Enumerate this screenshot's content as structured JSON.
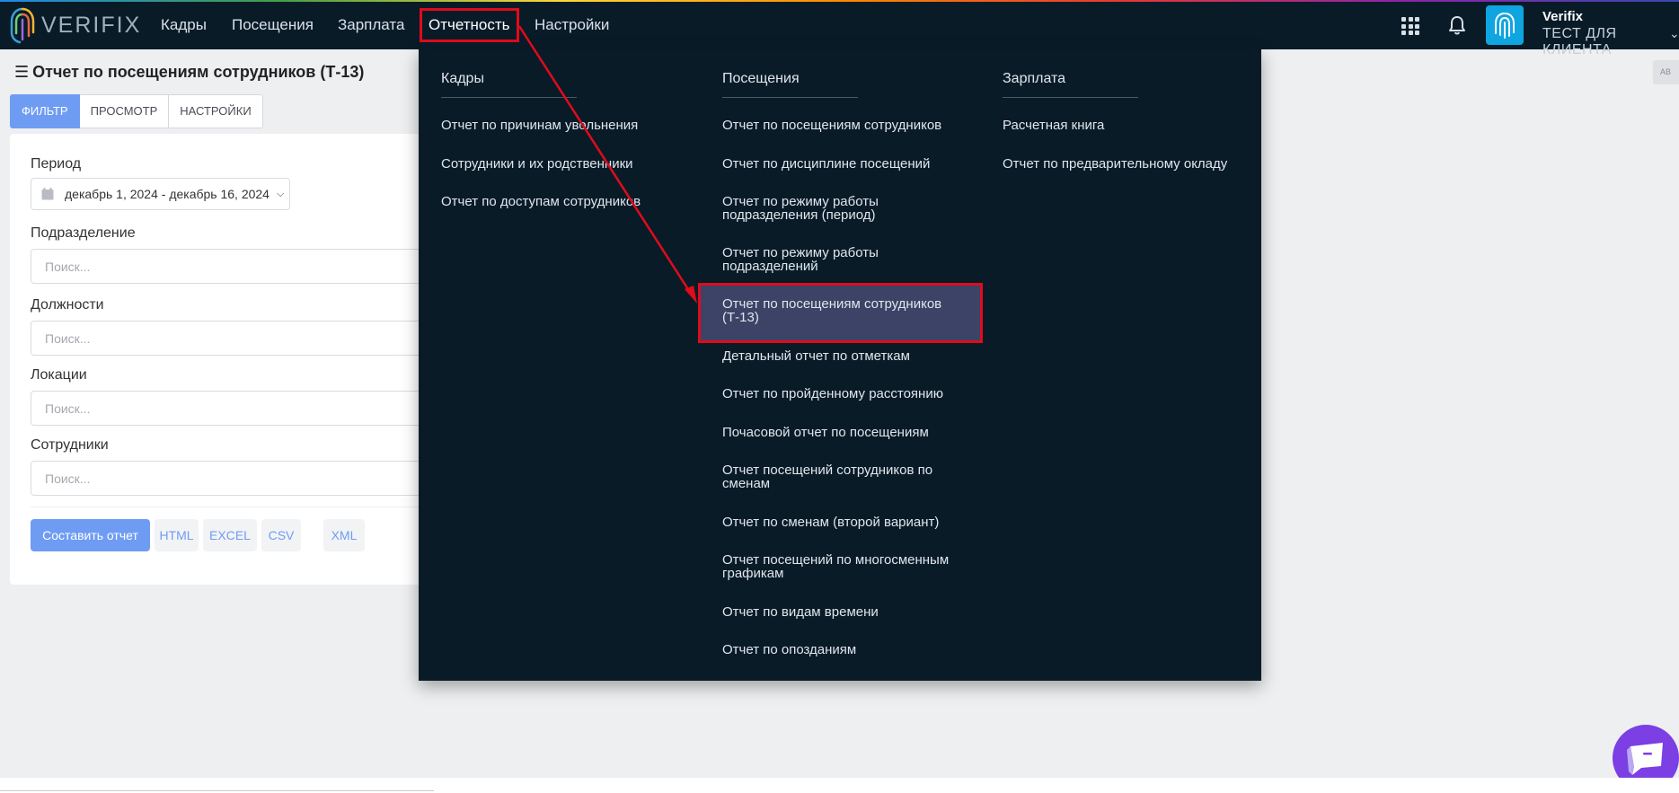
{
  "app": {
    "brand": "VERIFIX"
  },
  "nav": {
    "items": [
      "Кадры",
      "Посещения",
      "Зарплата",
      "Отчетность",
      "Настройки"
    ],
    "active": "Отчетность"
  },
  "user": {
    "name": "Verifix",
    "company": "ТЕСТ ДЛЯ КЛИЕНТА"
  },
  "page": {
    "title": "Отчет по посещениям сотрудников (Т-13)",
    "tabs": [
      "ФИЛЬТР",
      "ПРОСМОТР",
      "НАСТРОЙКИ"
    ],
    "active_tab": "ФИЛЬТР"
  },
  "filters": {
    "period_label": "Период",
    "period_value": "декабрь 1, 2024 - декабрь 16, 2024",
    "fields": [
      {
        "label": "Подразделение",
        "placeholder": "Поиск..."
      },
      {
        "label": "Должности",
        "placeholder": "Поиск..."
      },
      {
        "label": "Локации",
        "placeholder": "Поиск..."
      },
      {
        "label": "Сотрудники",
        "placeholder": "Поиск..."
      }
    ]
  },
  "actions": {
    "build": "Составить отчет",
    "exports": [
      "HTML",
      "EXCEL",
      "CSV",
      "XML"
    ]
  },
  "reports_menu": {
    "columns": [
      {
        "heading": "Кадры",
        "links": [
          "Отчет по причинам увольнения",
          "Сотрудники и их родственники",
          "Отчет по доступам сотрудников"
        ]
      },
      {
        "heading": "Посещения",
        "links": [
          "Отчет по посещениям сотрудников",
          "Отчет по дисциплине посещений",
          "Отчет по режиму работы подразделения (период)",
          "Отчет по режиму работы подразделений",
          "Отчет по посещениям сотрудников (Т-13)",
          "Детальный отчет по отметкам",
          "Отчет по пройденному расстоянию",
          "Почасовой отчет по посещениям",
          "Отчет посещений сотрудников по сменам",
          "Отчет по сменам (второй вариант)",
          "Отчет посещений по многосменным графикам",
          "Отчет по видам времени",
          "Отчет по опозданиям"
        ]
      },
      {
        "heading": "Зарплата",
        "links": [
          "Расчетная книга",
          "Отчет по предварительному окладу"
        ]
      }
    ],
    "selected": "Отчет по посещениям сотрудников (Т-13)"
  },
  "colors": {
    "topbar": "#0a1b28",
    "accent": "#6f9cf3",
    "highlight": "#e00b1b",
    "selected_item": "#3c4366",
    "chat": "#7b3fe4"
  },
  "icons": [
    "apps-grid-icon",
    "bell-icon",
    "fingerprint-icon",
    "calendar-icon",
    "chevron-down-icon",
    "hamburger-icon",
    "chat-icon"
  ]
}
